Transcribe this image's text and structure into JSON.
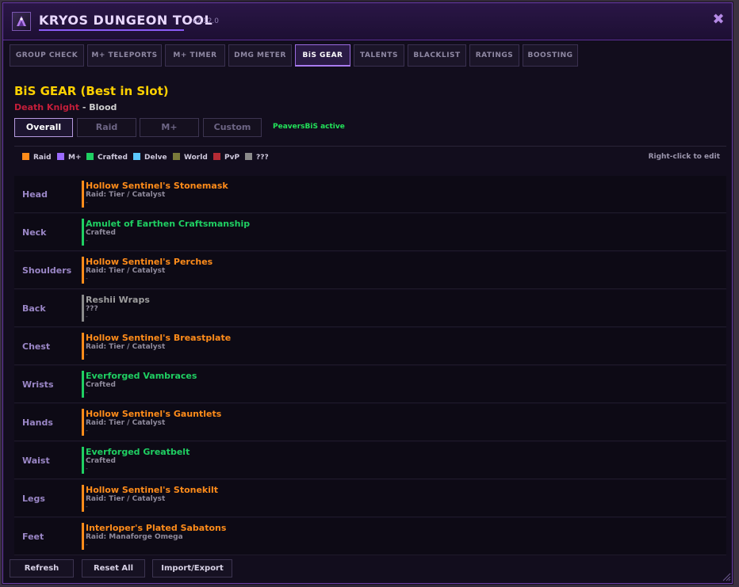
{
  "window": {
    "title": "KRYOS DUNGEON TOOL",
    "version": "v2.12.0",
    "close_icon": "✖"
  },
  "tabs": [
    {
      "label": "GROUP CHECK",
      "active": false
    },
    {
      "label": "M+ TELEPORTS",
      "active": false
    },
    {
      "label": "M+ TIMER",
      "active": false
    },
    {
      "label": "DMG METER",
      "active": false
    },
    {
      "label": "BiS GEAR",
      "active": true
    },
    {
      "label": "TALENTS",
      "active": false
    },
    {
      "label": "BLACKLIST",
      "active": false
    },
    {
      "label": "RATINGS",
      "active": false
    },
    {
      "label": "BOOSTING",
      "active": false
    }
  ],
  "section": {
    "title": "BiS GEAR (Best in Slot)",
    "class_name": "Death Knight",
    "separator": " - ",
    "spec_name": "Blood"
  },
  "subtabs": [
    {
      "label": "Overall",
      "active": true
    },
    {
      "label": "Raid",
      "active": false
    },
    {
      "label": "M+",
      "active": false
    },
    {
      "label": "Custom",
      "active": false
    }
  ],
  "peavers_status": "PeaversBiS active",
  "legend": {
    "items": [
      {
        "label": "Raid",
        "color": "#ff8c1a"
      },
      {
        "label": "M+",
        "color": "#9b6bff"
      },
      {
        "label": "Crafted",
        "color": "#1fcf62"
      },
      {
        "label": "Delve",
        "color": "#5cc8ff"
      },
      {
        "label": "World",
        "color": "#7a7a3a"
      },
      {
        "label": "PvP",
        "color": "#b52b35"
      },
      {
        "label": "???",
        "color": "#8a8a8a"
      }
    ],
    "hint": "Right-click to edit"
  },
  "gear": [
    {
      "slot": "Head",
      "item": "Hollow Sentinel's Stonemask",
      "source": "Raid: Tier / Catalyst",
      "extra": "-",
      "color": "#ff8c1a"
    },
    {
      "slot": "Neck",
      "item": "Amulet of Earthen Craftsmanship",
      "source": "Crafted",
      "extra": "-",
      "color": "#1fcf62"
    },
    {
      "slot": "Shoulders",
      "item": "Hollow Sentinel's Perches",
      "source": "Raid: Tier / Catalyst",
      "extra": "-",
      "color": "#ff8c1a"
    },
    {
      "slot": "Back",
      "item": "Reshii Wraps",
      "source": "???",
      "extra": "-",
      "color": "#8a8a8a"
    },
    {
      "slot": "Chest",
      "item": "Hollow Sentinel's Breastplate",
      "source": "Raid: Tier / Catalyst",
      "extra": "-",
      "color": "#ff8c1a"
    },
    {
      "slot": "Wrists",
      "item": "Everforged Vambraces",
      "source": "Crafted",
      "extra": "-",
      "color": "#1fcf62"
    },
    {
      "slot": "Hands",
      "item": "Hollow Sentinel's Gauntlets",
      "source": "Raid: Tier / Catalyst",
      "extra": "-",
      "color": "#ff8c1a"
    },
    {
      "slot": "Waist",
      "item": "Everforged Greatbelt",
      "source": "Crafted",
      "extra": "-",
      "color": "#1fcf62"
    },
    {
      "slot": "Legs",
      "item": "Hollow Sentinel's Stonekilt",
      "source": "Raid: Tier / Catalyst",
      "extra": "-",
      "color": "#ff8c1a"
    },
    {
      "slot": "Feet",
      "item": "Interloper's Plated Sabatons",
      "source": "Raid: Manaforge Omega",
      "extra": "-",
      "color": "#ff8c1a"
    }
  ],
  "buttons": {
    "refresh": "Refresh",
    "reset_all": "Reset All",
    "import_export": "Import/Export"
  }
}
